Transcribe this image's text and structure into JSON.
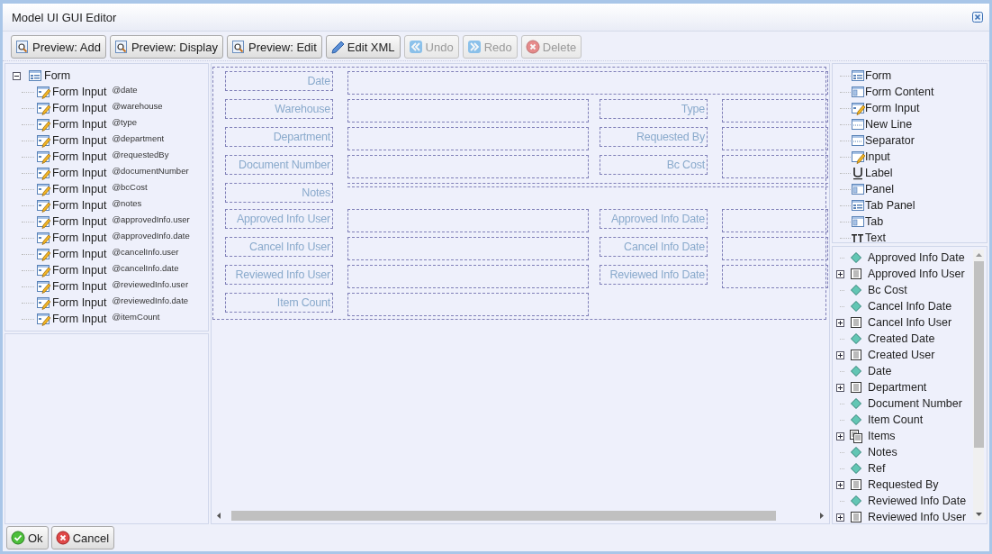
{
  "window": {
    "title": "Model UI GUI Editor"
  },
  "toolbar": [
    {
      "label": "Preview: Add",
      "kind": "preview",
      "disabled": false
    },
    {
      "label": "Preview: Display",
      "kind": "preview",
      "disabled": false
    },
    {
      "label": "Preview: Edit",
      "kind": "preview",
      "disabled": false
    },
    {
      "label": "Edit XML",
      "kind": "edit",
      "disabled": false
    },
    {
      "label": "Undo",
      "kind": "undo",
      "disabled": true
    },
    {
      "label": "Redo",
      "kind": "redo",
      "disabled": true
    },
    {
      "label": "Delete",
      "kind": "delete",
      "disabled": true
    }
  ],
  "outline": {
    "label": "Form",
    "kind": "form",
    "expanded": true,
    "children": [
      {
        "label": "Form Input",
        "kind": "form-input",
        "binding": "@date"
      },
      {
        "label": "Form Input",
        "kind": "form-input",
        "binding": "@warehouse"
      },
      {
        "label": "Form Input",
        "kind": "form-input",
        "binding": "@type"
      },
      {
        "label": "Form Input",
        "kind": "form-input",
        "binding": "@department"
      },
      {
        "label": "Form Input",
        "kind": "form-input",
        "binding": "@requestedBy"
      },
      {
        "label": "Form Input",
        "kind": "form-input",
        "binding": "@documentNumber"
      },
      {
        "label": "Form Input",
        "kind": "form-input",
        "binding": "@bcCost"
      },
      {
        "label": "Form Input",
        "kind": "form-input",
        "binding": "@notes"
      },
      {
        "label": "Form Input",
        "kind": "form-input",
        "binding": "@approvedInfo.user"
      },
      {
        "label": "Form Input",
        "kind": "form-input",
        "binding": "@approvedInfo.date"
      },
      {
        "label": "Form Input",
        "kind": "form-input",
        "binding": "@cancelInfo.user"
      },
      {
        "label": "Form Input",
        "kind": "form-input",
        "binding": "@cancelInfo.date"
      },
      {
        "label": "Form Input",
        "kind": "form-input",
        "binding": "@reviewedInfo.user"
      },
      {
        "label": "Form Input",
        "kind": "form-input",
        "binding": "@reviewedInfo.date"
      },
      {
        "label": "Form Input",
        "kind": "form-input",
        "binding": "@itemCount"
      }
    ]
  },
  "form": {
    "rows": [
      {
        "fields": [
          {
            "label": "Date",
            "kind": "wide"
          }
        ]
      },
      {
        "fields": [
          {
            "label": "Warehouse",
            "kind": "normal"
          },
          {
            "label": "Type",
            "kind": "normal"
          }
        ]
      },
      {
        "fields": [
          {
            "label": "Department",
            "kind": "normal"
          },
          {
            "label": "Requested By",
            "kind": "normal"
          }
        ]
      },
      {
        "fields": [
          {
            "label": "Document Number",
            "kind": "normal"
          },
          {
            "label": "Bc Cost",
            "kind": "normal"
          }
        ]
      },
      {
        "fields": [
          {
            "label": "Notes",
            "kind": "strip"
          }
        ]
      },
      {
        "fields": [
          {
            "label": "Approved Info User",
            "kind": "normal"
          },
          {
            "label": "Approved Info Date",
            "kind": "normal"
          }
        ]
      },
      {
        "fields": [
          {
            "label": "Cancel Info User",
            "kind": "normal"
          },
          {
            "label": "Cancel Info Date",
            "kind": "normal"
          }
        ]
      },
      {
        "fields": [
          {
            "label": "Reviewed Info User",
            "kind": "normal"
          },
          {
            "label": "Reviewed Info Date",
            "kind": "normal"
          }
        ]
      },
      {
        "fields": [
          {
            "label": "Item Count",
            "kind": "normal"
          }
        ]
      }
    ]
  },
  "palette": [
    {
      "label": "Form",
      "kind": "form"
    },
    {
      "label": "Form Content",
      "kind": "panel"
    },
    {
      "label": "Form Input",
      "kind": "form-input"
    },
    {
      "label": "New Line",
      "kind": "separator"
    },
    {
      "label": "Separator",
      "kind": "separator"
    },
    {
      "label": "Input",
      "kind": "input"
    },
    {
      "label": "Label",
      "kind": "label"
    },
    {
      "label": "Panel",
      "kind": "panel"
    },
    {
      "label": "Tab Panel",
      "kind": "form"
    },
    {
      "label": "Tab",
      "kind": "panel"
    },
    {
      "label": "Text",
      "kind": "text"
    }
  ],
  "fields": [
    {
      "label": "Approved Info Date",
      "kind": "field"
    },
    {
      "label": "Approved Info User",
      "kind": "group",
      "expanded": false
    },
    {
      "label": "Bc Cost",
      "kind": "field"
    },
    {
      "label": "Cancel Info Date",
      "kind": "field"
    },
    {
      "label": "Cancel Info User",
      "kind": "group",
      "expanded": false
    },
    {
      "label": "Created Date",
      "kind": "field"
    },
    {
      "label": "Created User",
      "kind": "group",
      "expanded": false
    },
    {
      "label": "Date",
      "kind": "field"
    },
    {
      "label": "Department",
      "kind": "group",
      "expanded": false
    },
    {
      "label": "Document Number",
      "kind": "field"
    },
    {
      "label": "Item Count",
      "kind": "field"
    },
    {
      "label": "Items",
      "kind": "collection",
      "expanded": false
    },
    {
      "label": "Notes",
      "kind": "field"
    },
    {
      "label": "Ref",
      "kind": "field"
    },
    {
      "label": "Requested By",
      "kind": "group",
      "expanded": false
    },
    {
      "label": "Reviewed Info Date",
      "kind": "field"
    },
    {
      "label": "Reviewed Info User",
      "kind": "group",
      "expanded": false
    }
  ],
  "footer": [
    {
      "label": "Ok",
      "kind": "ok"
    },
    {
      "label": "Cancel",
      "kind": "cancel"
    }
  ]
}
